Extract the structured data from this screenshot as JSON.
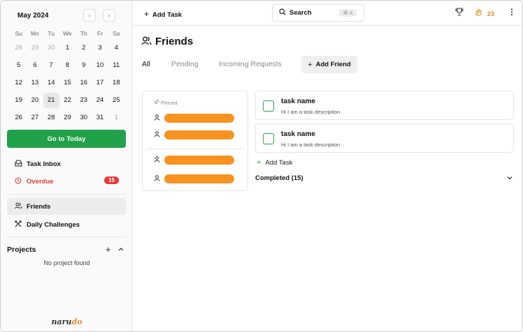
{
  "calendar": {
    "month_label": "May 2024",
    "prev_icon": "‹",
    "next_icon": "›",
    "weekdays": [
      "Su",
      "Mo",
      "Tu",
      "We",
      "Th",
      "Fr",
      "Sa"
    ],
    "weeks": [
      [
        "28",
        "29",
        "30",
        "1",
        "2",
        "3",
        "4"
      ],
      [
        "5",
        "6",
        "7",
        "8",
        "9",
        "10",
        "11"
      ],
      [
        "12",
        "13",
        "14",
        "15",
        "16",
        "17",
        "18"
      ],
      [
        "19",
        "20",
        "21",
        "22",
        "23",
        "24",
        "25"
      ],
      [
        "26",
        "27",
        "28",
        "29",
        "30",
        "31",
        "1"
      ]
    ],
    "today": "21"
  },
  "sidebar": {
    "goto_today": "Go to Today",
    "task_inbox": "Task Inbox",
    "overdue": "Overdue",
    "overdue_count": "15",
    "friends": "Friends",
    "daily_challenges": "Daily Challenges",
    "projects_title": "Projects",
    "no_project": "No project found",
    "logo_part1": "naru",
    "logo_part2": "do"
  },
  "topbar": {
    "add_task": "Add Task",
    "search_label": "Search",
    "search_shortcut": "⌘ K",
    "streak_count": "23"
  },
  "main": {
    "title": "Friends",
    "tabs": [
      "All",
      "Pending",
      "Incoming Requests"
    ],
    "active_tab": "All",
    "add_friend": "Add Friend",
    "pinned_label": "Pinned",
    "tasks": [
      {
        "name": "task name",
        "description": "Hi I am a task description"
      },
      {
        "name": "task name",
        "description": "Hi I am a task description"
      }
    ],
    "add_task_inline": "Add Task",
    "completed": "Completed (15)"
  },
  "colors": {
    "accent_green": "#22a14b",
    "overdue_red": "#e23b3b",
    "streak_orange": "#f08a24",
    "friend_bar_orange": "#f7931e"
  },
  "icons": {
    "inbox": "inbox-icon",
    "overdue": "clock-alert-icon",
    "friends": "users-icon",
    "challenges": "swords-icon",
    "search": "search-icon",
    "trophy": "trophy-icon",
    "streak": "flame-icon",
    "menu": "kebab-icon",
    "pin": "pin-icon",
    "user": "user-icon"
  }
}
